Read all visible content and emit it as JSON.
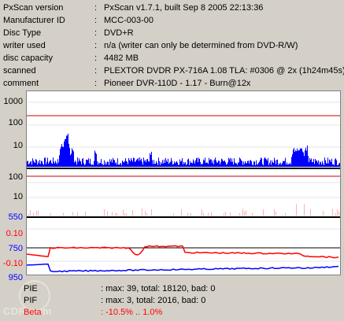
{
  "info": [
    {
      "key": "PxScan version",
      "value": "PxScan v1.7.1, built Sep  8 2005 22:13:36"
    },
    {
      "key": "Manufacturer ID",
      "value": "MCC-003-00"
    },
    {
      "key": "Disc Type",
      "value": "DVD+R"
    },
    {
      "key": "writer used",
      "value": "n/a (writer can only be determined from DVD-R/W)"
    },
    {
      "key": "disc capacity",
      "value": "4482 MB"
    },
    {
      "key": "scanned",
      "value": "PLEXTOR DVDR  PX-716A 1.08 TLA: #0306 @ 2x (1h24m45s)"
    },
    {
      "key": "comment",
      "value": "Pioneer DVR-110D - 1.17 - Burn@12x"
    }
  ],
  "axes": {
    "pie": [
      "1000",
      "100",
      "10"
    ],
    "pif": [
      "100",
      "10"
    ],
    "jitter_top": "550",
    "beta_top": "0.10",
    "jitter_mid": "750",
    "beta_bottom": "-0.10",
    "jitter_bottom": "950"
  },
  "colors": {
    "pie": "#0000ff",
    "pif": "#ff0000",
    "beta": "#ff0000",
    "jitter": "#0000ff",
    "threshold": "#cc0000",
    "label_blue": "#0000ff",
    "label_red": "#ff0000"
  },
  "stats": [
    {
      "name": "PIE",
      "value": ": max: 39, total: 18120, bad: 0",
      "color": "#000000"
    },
    {
      "name": "PIF",
      "value": ": max: 3, total: 2016, bad: 0",
      "color": "#000000"
    },
    {
      "name": "Beta",
      "value": ": -10.5% .. 1.0%",
      "color": "#ff0000"
    }
  ],
  "watermark": "CDR.com"
}
